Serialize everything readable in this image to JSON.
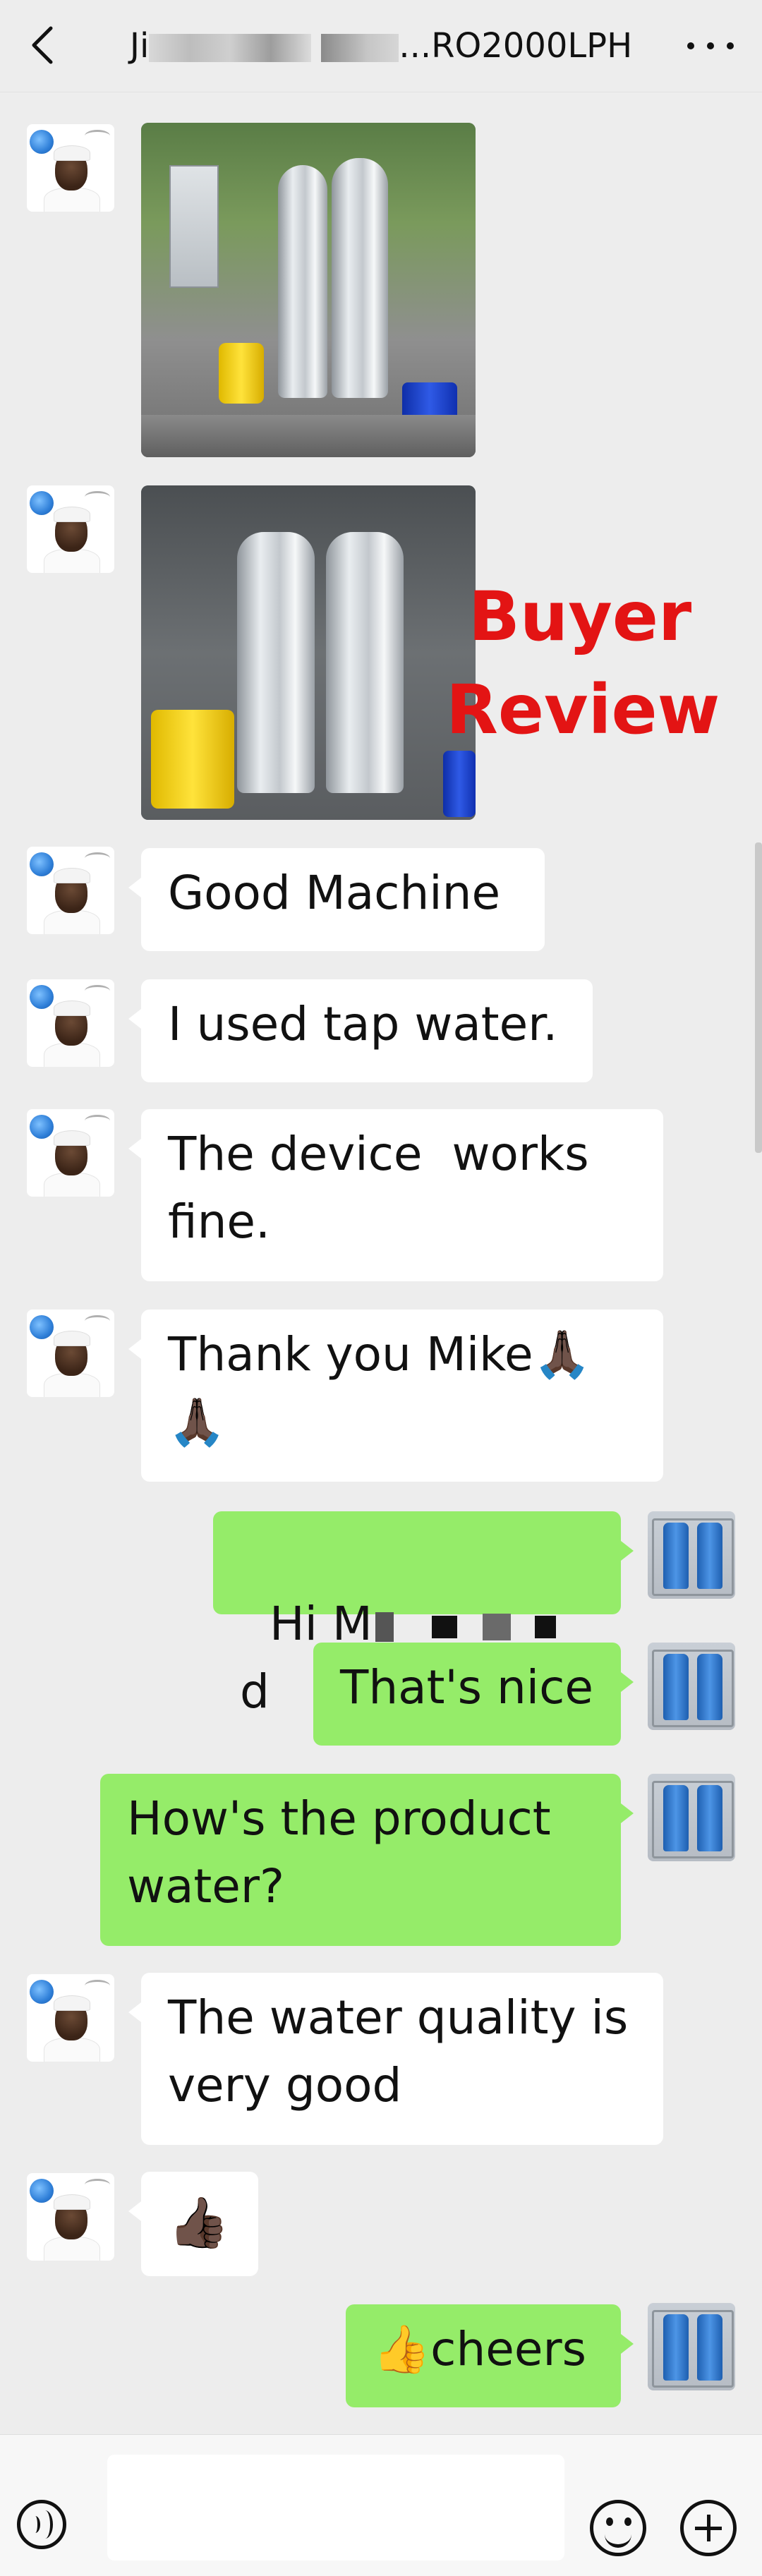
{
  "header": {
    "title_prefix": "Ji",
    "title_suffix": "...RO2000LPH"
  },
  "overlay": {
    "review_text": "Buyer\nReview",
    "review_color": "#e31414"
  },
  "colors": {
    "sent_bubble": "#95ec69",
    "received_bubble": "#ffffff",
    "background": "#ededed"
  },
  "messages": [
    {
      "side": "left",
      "type": "image",
      "icon": "water-treatment-photo"
    },
    {
      "side": "left",
      "type": "image",
      "icon": "water-treatment-photo"
    },
    {
      "side": "left",
      "type": "text",
      "text": "Good Machine"
    },
    {
      "side": "left",
      "type": "text",
      "text": "I used tap water."
    },
    {
      "side": "left",
      "type": "text",
      "text": "The device  works\nfine."
    },
    {
      "side": "left",
      "type": "text",
      "text": "Thank you Mike🙏🏿\n🙏🏿"
    },
    {
      "side": "right",
      "type": "text",
      "text_start": "Hi M",
      "text_end": "d"
    },
    {
      "side": "right",
      "type": "text",
      "text": "That's nice"
    },
    {
      "side": "right",
      "type": "text",
      "text": "How's the product\nwater?"
    },
    {
      "side": "left",
      "type": "text",
      "text": "The water quality is\nvery good"
    },
    {
      "side": "left",
      "type": "emoji",
      "text": "👍🏿"
    },
    {
      "side": "right",
      "type": "text",
      "text": "👍cheers"
    }
  ],
  "footer": {
    "icons": [
      "voice-icon",
      "emoji-icon",
      "plus-icon"
    ]
  }
}
